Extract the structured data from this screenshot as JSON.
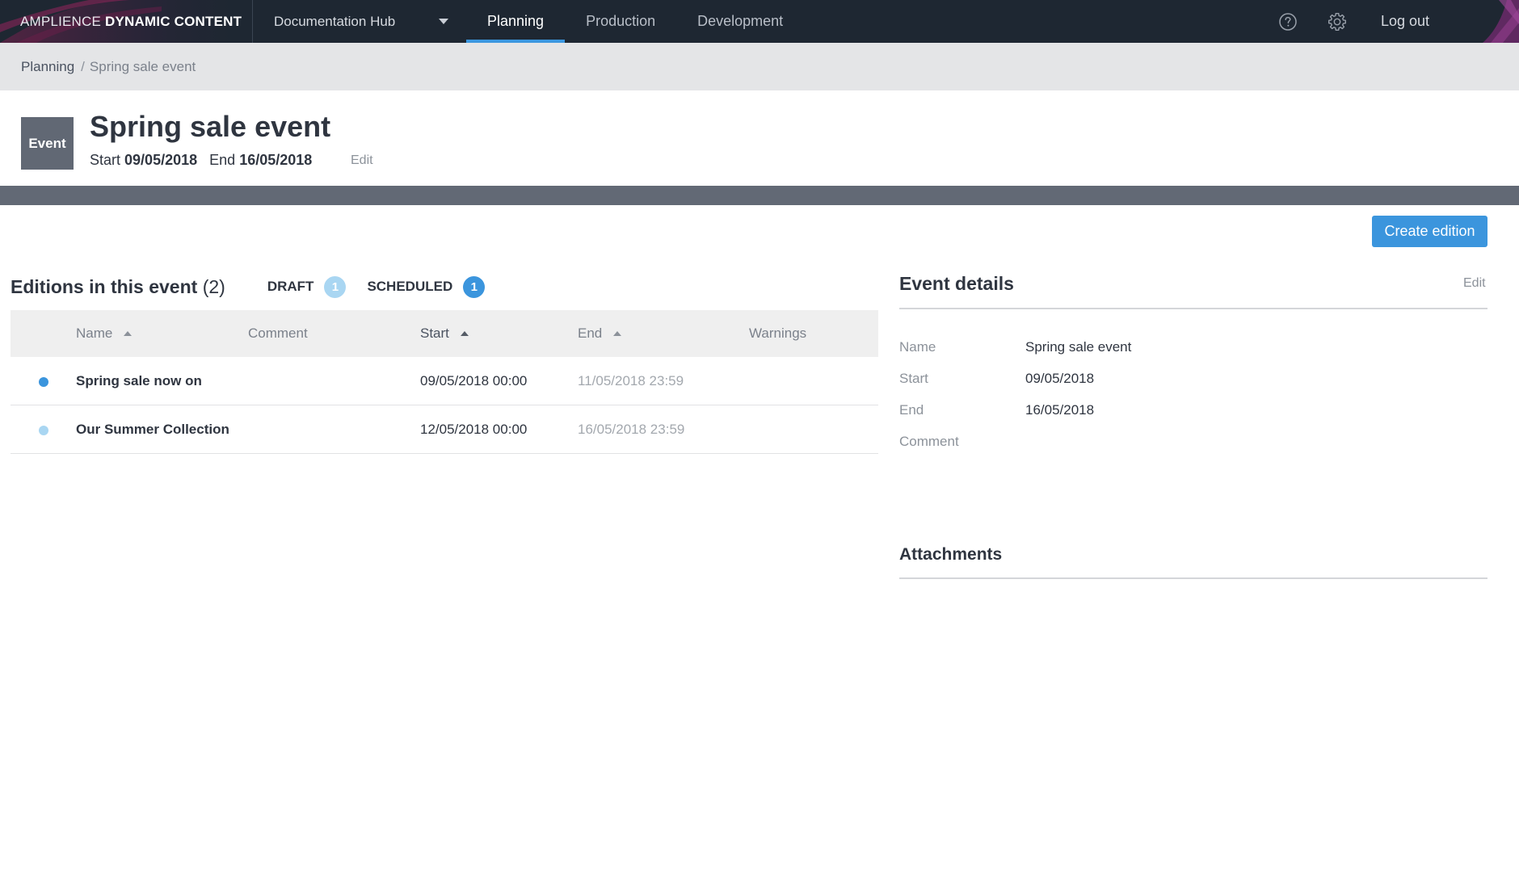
{
  "brand": {
    "prefix": "AMPLIENCE ",
    "strong": "DYNAMIC CONTENT"
  },
  "hub": {
    "label": "Documentation Hub"
  },
  "nav": {
    "tabs": [
      {
        "label": "Planning",
        "active": true
      },
      {
        "label": "Production",
        "active": false
      },
      {
        "label": "Development",
        "active": false
      }
    ],
    "logout": "Log out"
  },
  "breadcrumb": {
    "root": "Planning",
    "separator": "/",
    "current": "Spring sale event"
  },
  "event": {
    "badge": "Event",
    "title": "Spring sale event",
    "start_label": "Start",
    "start": "09/05/2018",
    "end_label": "End",
    "end": "16/05/2018",
    "edit": "Edit"
  },
  "actions": {
    "create_edition": "Create edition"
  },
  "editions": {
    "title": "Editions in this event",
    "count": "(2)",
    "statuses": [
      {
        "label": "DRAFT",
        "count": "1"
      },
      {
        "label": "SCHEDULED",
        "count": "1"
      }
    ],
    "columns": {
      "name": "Name",
      "comment": "Comment",
      "start": "Start",
      "end": "End",
      "warnings": "Warnings"
    },
    "rows": [
      {
        "name": "Spring sale now on",
        "comment": "",
        "start": "09/05/2018 00:00",
        "end": "11/05/2018 23:59",
        "status": "scheduled"
      },
      {
        "name": "Our Summer Collection",
        "comment": "",
        "start": "12/05/2018 00:00",
        "end": "16/05/2018 23:59",
        "status": "draft"
      }
    ]
  },
  "details": {
    "title": "Event details",
    "edit": "Edit",
    "fields": [
      {
        "label": "Name",
        "value": "Spring sale event"
      },
      {
        "label": "Start",
        "value": "09/05/2018"
      },
      {
        "label": "End",
        "value": "16/05/2018"
      },
      {
        "label": "Comment",
        "value": ""
      }
    ],
    "attachments_title": "Attachments"
  },
  "colors": {
    "nav_bg": "#1e2732",
    "accent": "#3b95dd",
    "draft": "#a9d6f2",
    "badge": "#616874"
  },
  "icons": [
    "help-icon",
    "gear-icon",
    "chevron-down-icon",
    "sort-ascending-icon"
  ]
}
